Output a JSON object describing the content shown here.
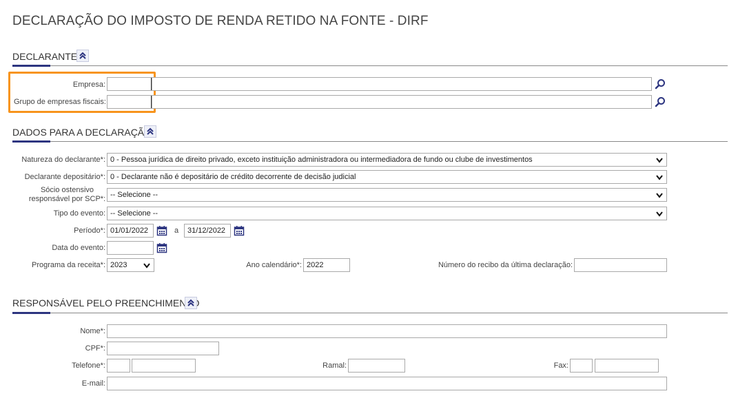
{
  "page": {
    "title": "DECLARAÇÃO DO IMPOSTO DE RENDA RETIDO NA FONTE - DIRF"
  },
  "sections": {
    "declarante": {
      "title": "DECLARANTE"
    },
    "dados": {
      "title": "DADOS PARA A DECLARAÇÃO"
    },
    "responsavel": {
      "title": "RESPONSÁVEL PELO PREENCHIMENTO"
    }
  },
  "declarante": {
    "empresa": {
      "label": "Empresa:",
      "code": "",
      "name": ""
    },
    "grupo": {
      "label": "Grupo de empresas fiscais:",
      "code": "",
      "name": ""
    }
  },
  "dados": {
    "natureza": {
      "label": "Natureza do declarante*:",
      "value": "0 - Pessoa jurídica de direito privado, exceto instituição administradora ou intermediadora de fundo ou clube de investimentos"
    },
    "depositario": {
      "label": "Declarante depositário*:",
      "value": "0 - Declarante não é depositário de crédito decorrente de decisão judicial"
    },
    "socio": {
      "label_line1": "Sócio ostensivo",
      "label_line2": "responsável por SCP*:",
      "value": "-- Selecione --"
    },
    "tipo_evento": {
      "label": "Tipo do evento:",
      "value": "-- Selecione --"
    },
    "periodo": {
      "label": "Período*:",
      "start": "01/01/2022",
      "sep": "a",
      "end": "31/12/2022"
    },
    "data_evento": {
      "label": "Data do evento:",
      "value": ""
    },
    "programa": {
      "label": "Programa da receita*:",
      "value": "2023"
    },
    "ano": {
      "label": "Ano calendário*:",
      "value": "2022"
    },
    "recibo": {
      "label": "Número do recibo da última declaração:",
      "value": ""
    }
  },
  "responsavel": {
    "nome": {
      "label": "Nome*:",
      "value": ""
    },
    "cpf": {
      "label": "CPF*:",
      "value": ""
    },
    "telefone": {
      "label": "Telefone*:",
      "ddd": "",
      "number": ""
    },
    "ramal": {
      "label": "Ramal:",
      "value": ""
    },
    "fax": {
      "label": "Fax:",
      "ddd": "",
      "number": ""
    },
    "email": {
      "label": "E-mail:",
      "value": ""
    }
  },
  "colors": {
    "accent": "#2d3580",
    "highlight": "#f7941d"
  }
}
